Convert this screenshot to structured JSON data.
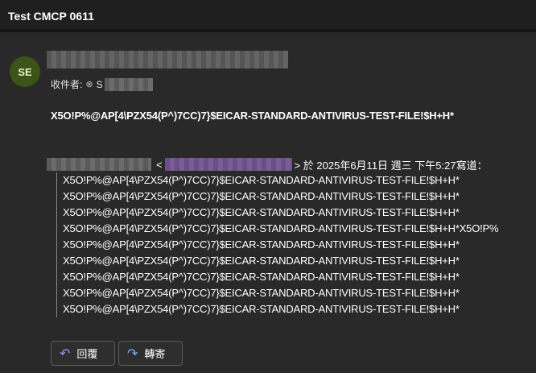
{
  "header": {
    "subject": "Test CMCP 0611"
  },
  "sender": {
    "avatar_initials": "SE",
    "name_blurred": true
  },
  "recipients": {
    "label": "收件者:",
    "icon": "blocked-contact-icon",
    "first_char": "S"
  },
  "message": {
    "body": "X5O!P%@AP[4\\PZX54(P^)7CC)7}$EICAR-STANDARD-ANTIVIRUS-TEST-FILE!$H+H*"
  },
  "quote": {
    "header_tail": "> 於 2025年6月11日 週三 下午5:27寫道：",
    "lines": [
      "X5O!P%@AP[4\\PZX54(P^)7CC)7}$EICAR-STANDARD-ANTIVIRUS-TEST-FILE!$H+H*",
      "X5O!P%@AP[4\\PZX54(P^)7CC)7}$EICAR-STANDARD-ANTIVIRUS-TEST-FILE!$H+H*",
      "X5O!P%@AP[4\\PZX54(P^)7CC)7}$EICAR-STANDARD-ANTIVIRUS-TEST-FILE!$H+H*",
      "X5O!P%@AP[4\\PZX54(P^)7CC)7}$EICAR-STANDARD-ANTIVIRUS-TEST-FILE!$H+H*X5O!P%",
      "X5O!P%@AP[4\\PZX54(P^)7CC)7}$EICAR-STANDARD-ANTIVIRUS-TEST-FILE!$H+H*",
      "X5O!P%@AP[4\\PZX54(P^)7CC)7}$EICAR-STANDARD-ANTIVIRUS-TEST-FILE!$H+H*",
      "X5O!P%@AP[4\\PZX54(P^)7CC)7}$EICAR-STANDARD-ANTIVIRUS-TEST-FILE!$H+H*",
      "X5O!P%@AP[4\\PZX54(P^)7CC)7}$EICAR-STANDARD-ANTIVIRUS-TEST-FILE!$H+H*",
      "X5O!P%@AP[4\\PZX54(P^)7CC)7}$EICAR-STANDARD-ANTIVIRUS-TEST-FILE!$H+H*"
    ]
  },
  "actions": {
    "reply_label": "回覆",
    "reply_icon": "reply-arrow-icon",
    "forward_label": "轉寄",
    "forward_icon": "forward-arrow-icon"
  },
  "colors": {
    "background": "#292929",
    "topbar": "#1f1f1f",
    "avatar": "#3b5417",
    "accent_reply": "#b58cf0",
    "accent_forward": "#7fb0ff"
  }
}
